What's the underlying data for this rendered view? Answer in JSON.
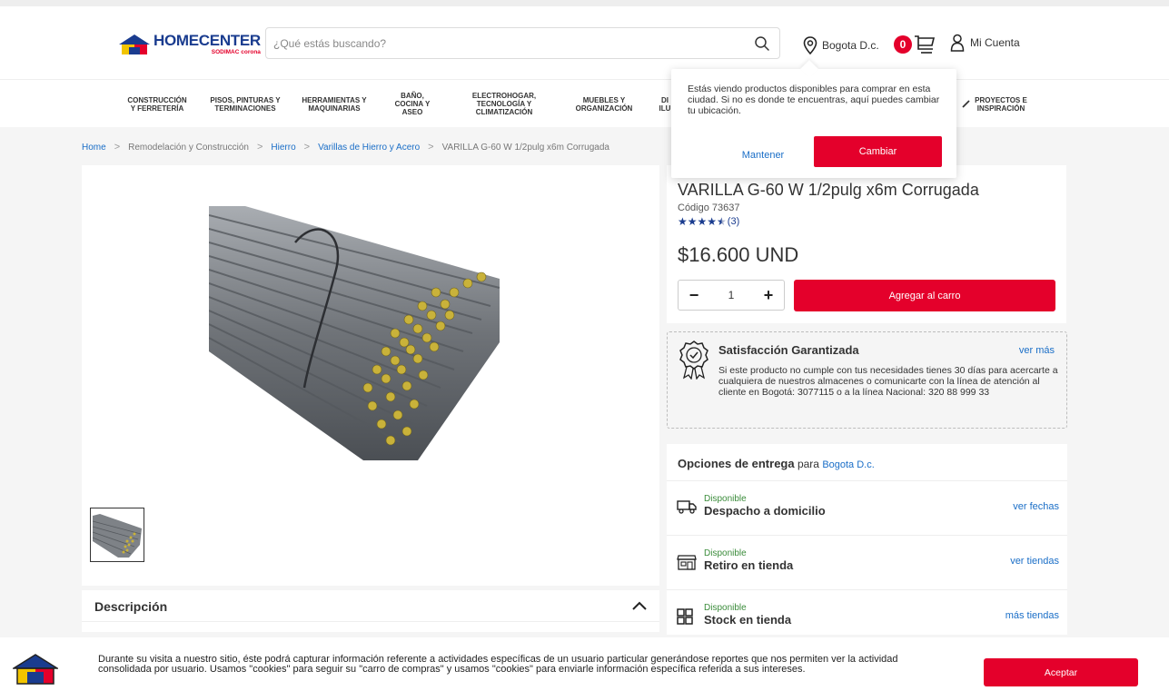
{
  "brand": {
    "name": "HOMECENTER",
    "subtitle": "SODIMAC corona",
    "colors": {
      "primary_blue": "#1a3c8f",
      "accent_red": "#e4002b",
      "link_blue": "#1a6ec7",
      "success_green": "#3b8c3b"
    }
  },
  "header": {
    "search_placeholder": "¿Qué estás buscando?",
    "location": "Bogota D.c.",
    "cart_count": "0",
    "account_label": "Mi Cuenta"
  },
  "nav": {
    "items": [
      {
        "label": "CONSTRUCCIÓN\nY FERRETERÍA"
      },
      {
        "label": "PISOS, PINTURAS Y\nTERMINACIONES"
      },
      {
        "label": "HERRAMIENTAS Y\nMAQUINARIAS"
      },
      {
        "label": "BAÑO,\nCOCINA Y\nASEO"
      },
      {
        "label": "ELECTROHOGAR,\nTECNOLOGÍA Y\nCLIMATIZACIÓN"
      },
      {
        "label": "MUEBLES Y\nORGANIZACIÓN"
      },
      {
        "label": "DI\nILU"
      },
      {
        "label": "PROYECTOS E\nINSPIRACIÓN"
      }
    ]
  },
  "breadcrumb": {
    "home": "Home",
    "level1": "Remodelación y Construcción",
    "level2": "Hierro",
    "level3": "Varillas de Hierro y Acero",
    "current": "VARILLA G-60 W 1/2pulg x6m Corrugada"
  },
  "location_popup": {
    "message": "Estás viendo productos disponibles para comprar en esta ciudad. Si no es donde te encuentras, aquí puedes cambiar tu ubicación.",
    "keep_label": "Mantener",
    "change_label": "Cambiar"
  },
  "product": {
    "title": "VARILLA G-60 W 1/2pulg x6m Corrugada",
    "code": "Código 73637",
    "rating": 4.5,
    "reviews": "(3)",
    "price": "$16.600 UND",
    "quantity": "1",
    "add_to_cart": "Agregar al carro"
  },
  "satisfaction": {
    "title": "Satisfacción Garantizada",
    "more": "ver más",
    "text": "Si este producto no cumple con tus necesidades tienes 30 días para acercarte a cualquiera de nuestros almacenes o comunicarte con la línea de atención al cliente en Bogotá: 3077115 o a la línea Nacional: 320 88 999 33"
  },
  "delivery": {
    "heading": "Opciones de entrega",
    "for_label": "para",
    "city": "Bogota D.c.",
    "options": [
      {
        "status": "Disponible",
        "name": "Despacho a domicilio",
        "link": "ver fechas",
        "icon": "truck-icon"
      },
      {
        "status": "Disponible",
        "name": "Retiro en tienda",
        "link": "ver tiendas",
        "icon": "store-icon"
      },
      {
        "status": "Disponible",
        "name": "Stock en tienda",
        "link": "más tiendas",
        "icon": "grid-icon"
      }
    ]
  },
  "description": {
    "title": "Descripción"
  },
  "cookie": {
    "text": "Durante su visita a nuestro sitio, éste podrá capturar información referente a actividades específicas de un usuario particular generándose reportes que nos permiten ver la actividad consolidada por usuario. Usamos \"cookies\" para seguir su \"carro de compras\" y usamos \"cookies\" para enviarle información específica referida a sus intereses.",
    "accept": "Aceptar"
  }
}
